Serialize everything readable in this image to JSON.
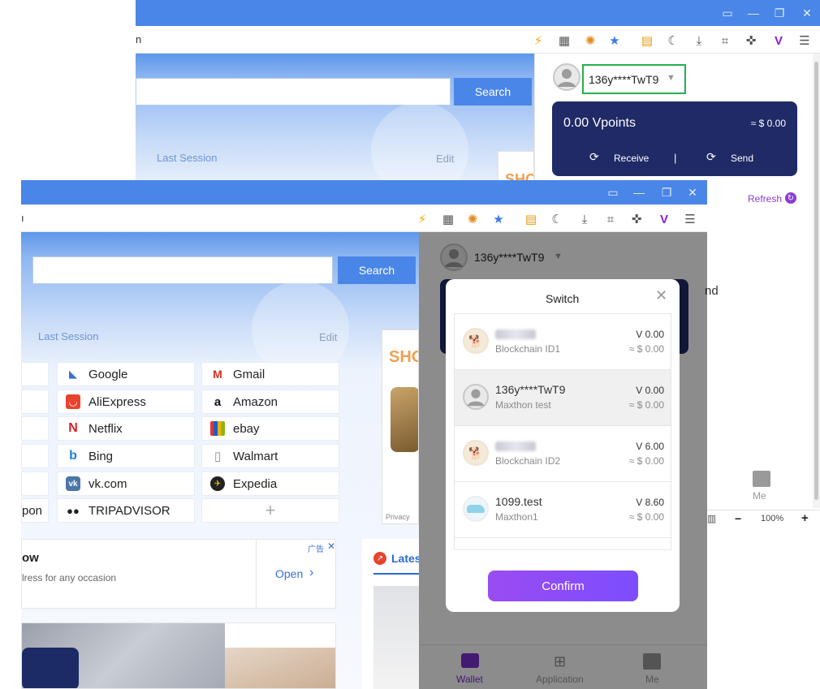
{
  "back_window": {
    "address_fragment": "n",
    "search_button": "Search",
    "last_session": "Last Session",
    "edit": "Edit",
    "ad_fragment": "SHO",
    "panel": {
      "username": "136y****TwT9",
      "wallet_amount": "0.00 Vpoints",
      "wallet_usd": "≈ $ 0.00",
      "receive": "Receive",
      "separator": "|",
      "send": "Send",
      "refresh": "Refresh",
      "nav_me": "Me",
      "zoom": "100%",
      "zoom_minus": "−",
      "zoom_plus": "+"
    }
  },
  "front_window": {
    "address_fragment": "ı",
    "search_button": "Search",
    "last_session": "Last Session",
    "edit": "Edit",
    "ad_fragment": "SHO",
    "ad_privacy": "Privacy",
    "quick_links_col2": [
      {
        "label": "Google",
        "icon": "google-icon"
      },
      {
        "label": "AliExpress",
        "icon": "aliexpress-icon"
      },
      {
        "label": "Netflix",
        "icon": "netflix-icon"
      },
      {
        "label": "Bing",
        "icon": "bing-icon"
      },
      {
        "label": "vk.com",
        "icon": "vk-icon"
      },
      {
        "label": "TRIPADVISOR",
        "icon": "tripadvisor-icon"
      }
    ],
    "quick_links_col3": [
      {
        "label": "Gmail",
        "icon": "gmail-icon"
      },
      {
        "label": "Amazon",
        "icon": "amazon-icon"
      },
      {
        "label": "ebay",
        "icon": "ebay-icon"
      },
      {
        "label": "Walmart",
        "icon": "walmart-icon"
      },
      {
        "label": "Expedia",
        "icon": "expedia-icon"
      }
    ],
    "quick_links_col1_fragment": "pon",
    "add_tile": "+",
    "ad_card": {
      "title_fragment": "ow",
      "desc_fragment": "lress for any occasion",
      "open": "Open",
      "ad_label": "广告"
    },
    "latest_fragment": "Lates",
    "panel": {
      "username": "136y****TwT9",
      "behind_text": "nd",
      "nav_wallet": "Wallet",
      "nav_application": "Application",
      "nav_me": "Me"
    }
  },
  "switch_dialog": {
    "title": "Switch",
    "confirm": "Confirm",
    "accounts": [
      {
        "name": "",
        "sub": "Blockchain ID1",
        "v": "V 0.00",
        "usd": "≈ $ 0.00",
        "blurred": true,
        "avatar": "dog-avatar"
      },
      {
        "name": "136y****TwT9",
        "sub": "Maxthon test",
        "v": "V 0.00",
        "usd": "≈ $ 0.00",
        "blurred": false,
        "avatar": "default-avatar"
      },
      {
        "name": "",
        "sub": "Blockchain ID2",
        "v": "V 6.00",
        "usd": "≈ $ 0.00",
        "blurred": true,
        "avatar": "dog-avatar"
      },
      {
        "name": "1099.test",
        "sub": "Maxthon1",
        "v": "V 8.60",
        "usd": "≈ $ 0.00",
        "blurred": false,
        "avatar": "shoe-avatar"
      }
    ]
  },
  "colors": {
    "titlebar": "#4a86e8",
    "wallet_card": "#1f2a66",
    "confirm_gradient_start": "#7c4dff",
    "confirm_gradient_end": "#b04df0",
    "highlight_box": "#22b24c"
  }
}
